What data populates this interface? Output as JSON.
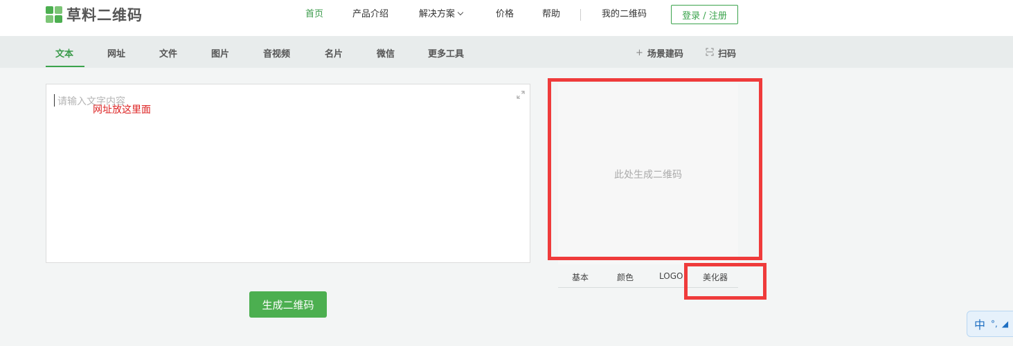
{
  "header": {
    "logo_text": "草料二维码",
    "nav": [
      {
        "label": "首页"
      },
      {
        "label": "产品介绍"
      },
      {
        "label": "解决方案"
      },
      {
        "label": "价格"
      },
      {
        "label": "帮助"
      },
      {
        "label": "我的二维码"
      }
    ],
    "login_label": "登录 / 注册"
  },
  "tabs": [
    {
      "label": "文本"
    },
    {
      "label": "网址"
    },
    {
      "label": "文件"
    },
    {
      "label": "图片"
    },
    {
      "label": "音视频"
    },
    {
      "label": "名片"
    },
    {
      "label": "微信"
    },
    {
      "label": "更多工具"
    }
  ],
  "tools": {
    "scene_label": "场景建码",
    "scan_label": "扫码"
  },
  "editor": {
    "placeholder": "请输入文字内容",
    "annotation": "网址放这里面"
  },
  "generate_label": "生成二维码",
  "qr_preview": {
    "placeholder": "此处生成二维码"
  },
  "style_tabs": [
    {
      "label": "基本"
    },
    {
      "label": "颜色"
    },
    {
      "label": "LOGO"
    },
    {
      "label": "美化器"
    }
  ],
  "ime": {
    "mode_label": "中"
  },
  "colors": {
    "brand_green": "#3aa34b",
    "annotation_red": "#ef3b3b"
  }
}
